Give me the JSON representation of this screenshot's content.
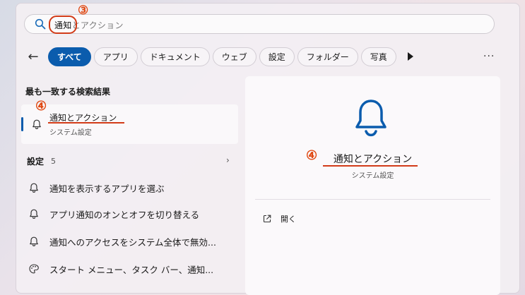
{
  "search": {
    "typed": "通知",
    "suggestion": "とアクション",
    "marker": "③"
  },
  "filters": {
    "back_label": "←",
    "chips": [
      "すべて",
      "アプリ",
      "ドキュメント",
      "ウェブ",
      "設定",
      "フォルダー",
      "写真"
    ],
    "more_label": "···"
  },
  "left": {
    "best_match_heading": "最も一致する検索結果",
    "best_match": {
      "title": "通知とアクション",
      "subtitle": "システム設定",
      "marker": "④"
    },
    "settings_heading": "設定",
    "settings_count": "5",
    "chevron": "›",
    "items": [
      "通知を表示するアプリを選ぶ",
      "アプリ通知のオンとオフを切り替える",
      "通知へのアクセスをシステム全体で無効...",
      "スタート メニュー、タスク バー、通知..."
    ]
  },
  "right": {
    "title": "通知とアクション",
    "subtitle": "システム設定",
    "marker": "④",
    "open_label": "開く"
  },
  "colors": {
    "accent": "#0b5cad",
    "annotation": "#d23b18"
  }
}
